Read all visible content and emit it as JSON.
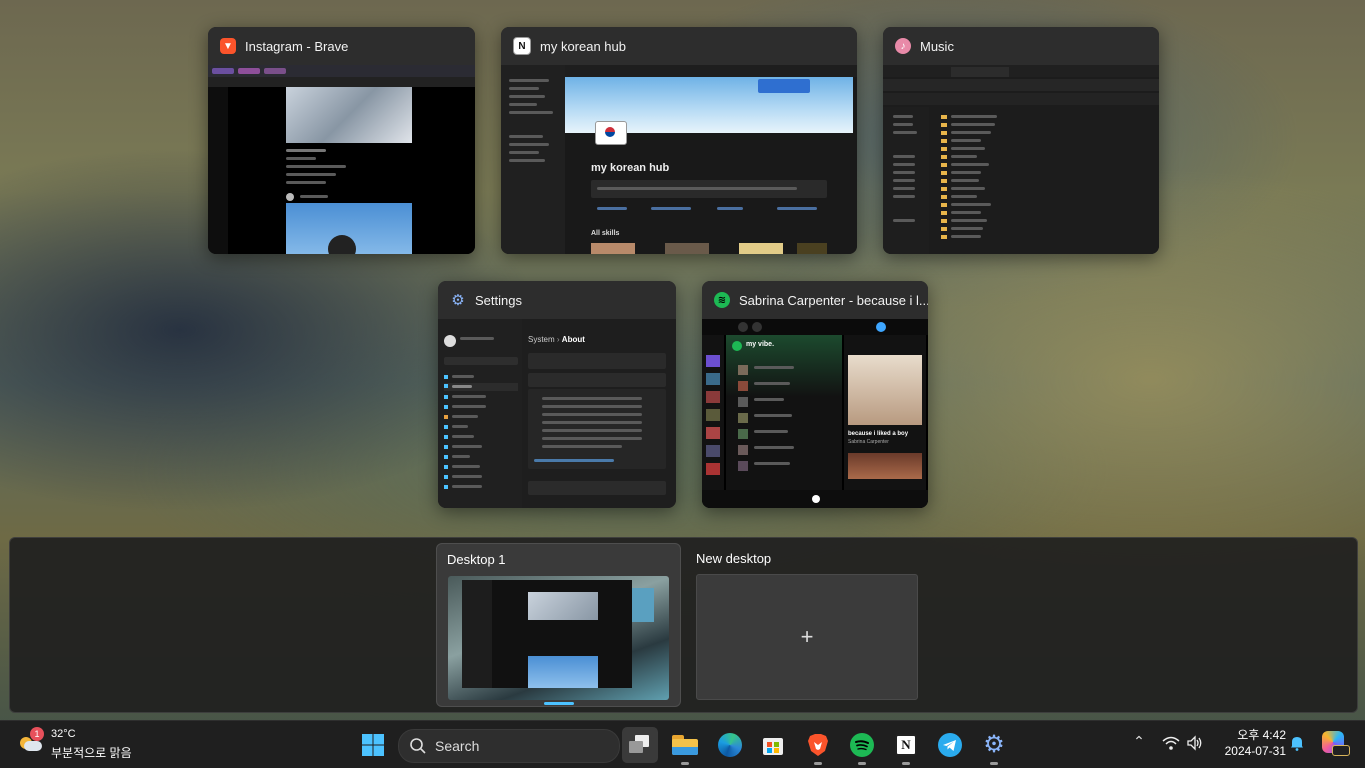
{
  "windows": [
    {
      "title": "Instagram - Brave"
    },
    {
      "title": "my korean hub"
    },
    {
      "title": "Music"
    },
    {
      "title": "Settings"
    },
    {
      "title": "Sabrina Carpenter - because i l..."
    }
  ],
  "notion_thumb": {
    "heading": "my korean hub",
    "section": "All skills"
  },
  "settings_thumb": {
    "breadcrumb_parent": "System",
    "breadcrumb_current": "About"
  },
  "spotify_thumb": {
    "playlist": "my vibe.",
    "song": "because i liked a boy",
    "artist": "Sabrina Carpenter"
  },
  "desktops": {
    "current_label": "Desktop 1",
    "new_label": "New desktop",
    "new_symbol": "+"
  },
  "taskbar": {
    "weather_temp": "32°C",
    "weather_desc": "부분적으로 맑음",
    "weather_badge": "1",
    "search_label": "Search",
    "time": "오후 4:42",
    "date": "2024-07-31"
  },
  "colors": {
    "accent": "#4cc2ff",
    "spotify_green": "#1db954",
    "brave_orange": "#fb542b"
  }
}
